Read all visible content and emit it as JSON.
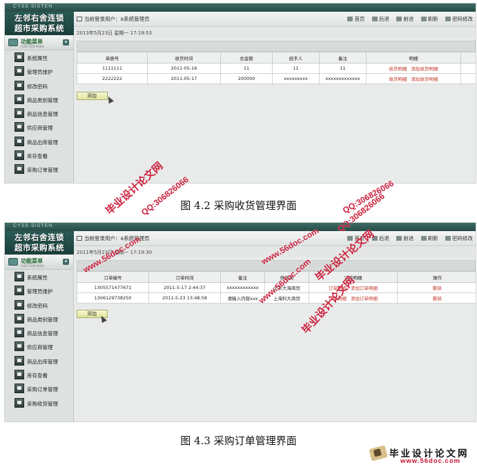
{
  "shots": [
    {
      "brand": "CYSS SISTEN",
      "logo": [
        "左邻右舍连锁",
        "超市采购系统"
      ],
      "current_user": "当前登录用户：a系统管理员",
      "nav": [
        "首页",
        "后退",
        "前进",
        "刷新",
        "密码修改"
      ],
      "datetime": "2013年5月23日 星期一 17:19:53",
      "menu": {
        "title": "功能菜单",
        "subtitle": "FUNCTION MENU",
        "items": [
          "系统属性",
          "管理员维护",
          "修改密码",
          "商品类别管理",
          "商品信息管理",
          "供应商管理",
          "商品出库管理",
          "库存查看",
          "采购订单管理"
        ]
      },
      "table": {
        "columns": [
          "单据号",
          "收货时间",
          "总金额",
          "经手人",
          "备注",
          "明细",
          ""
        ],
        "rows": [
          [
            "1111111",
            "2011-05-16",
            "11",
            "11",
            "11"
          ],
          [
            "2222222",
            "2011-05-17",
            "200000",
            "xxxxxxxxx",
            "xxxxxxxxxxxxx"
          ]
        ],
        "row_links": [
          "收货明细",
          "添加收货明细"
        ]
      },
      "add_label": "添加"
    },
    {
      "brand": "CYSS SISTEN",
      "logo": [
        "左邻右舍连锁",
        "超市采购系统"
      ],
      "current_user": "当前登录用户：a系统管理员",
      "nav": [
        "首页",
        "后退",
        "前进",
        "刷新",
        "密码修改"
      ],
      "datetime": "2011年5月23日 星期一 17:19:30",
      "menu": {
        "title": "功能菜单",
        "subtitle": "FUNCTION MENU",
        "items": [
          "系统属性",
          "管理员维护",
          "修改密码",
          "商品类别管理",
          "商品信息管理",
          "供应商管理",
          "商品出库管理",
          "库存查看",
          "采购订单管理",
          "采购收货管理"
        ]
      },
      "table": {
        "columns": [
          "订单编号",
          "订单时间",
          "备注",
          "供应商",
          "订单明细",
          "操作"
        ],
        "rows": [
          [
            "1305571477671",
            "2011-5-17 2:44:37",
            "xxxxxxxxxxxx",
            "北京大海商贸"
          ],
          [
            "1306129738250",
            "2011-5-23 13:48:58",
            "请输入内容xxx",
            "上海科大商贸"
          ]
        ],
        "row_links": [
          "订单明细",
          "添加订单明细"
        ],
        "row_action": "删除"
      },
      "add_label": "添加"
    }
  ],
  "captions": [
    "图 4.2 采购收货管理界面",
    "图 4.3 采购订单管理界面"
  ],
  "watermarks": [
    "毕业设计论文网",
    "www.56doc.com",
    "QQ:306826066",
    "QQ:306826066",
    "毕业设计论文网",
    "www.56doc.com",
    "www.56doc.com",
    "QQ:306826066",
    "毕业设计论文网"
  ],
  "footer_logo": {
    "name": "毕业设计论文网",
    "url": "www.56doc.com"
  },
  "colors": {
    "watermark": "#c8102e",
    "link": "#c0392b",
    "header": "#2a5a55"
  }
}
